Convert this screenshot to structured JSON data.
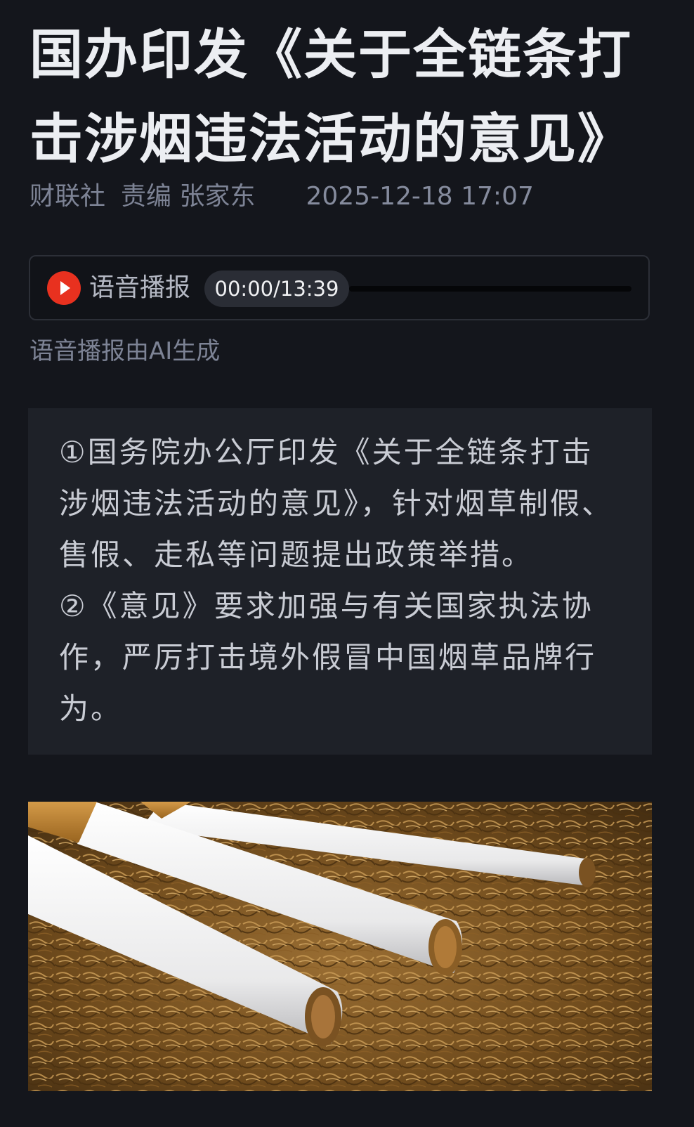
{
  "article": {
    "title": "国办印发《关于全链条打击涉烟违法活动的意见》",
    "source": "财联社",
    "editor": "责编 张家东",
    "timestamp": "2025-12-18 17:07"
  },
  "audio": {
    "label": "语音播报",
    "time": "00:00/13:39",
    "progress_fraction": 0,
    "ai_note": "语音播报由AI生成"
  },
  "summary": {
    "point1": "①国务院办公厅印发《关于全链条打击涉烟违法活动的意见》，针对烟草制假、售假、走私等问题提出政策举措。",
    "point2": "②《意见》要求加强与有关国家执法协作，严厉打击境外假冒中国烟草品牌行为。"
  },
  "colors": {
    "background": "#14161c",
    "accent": "#e8311f",
    "summary_bg": "#1e2128"
  },
  "icons": {
    "play": "play-icon"
  }
}
